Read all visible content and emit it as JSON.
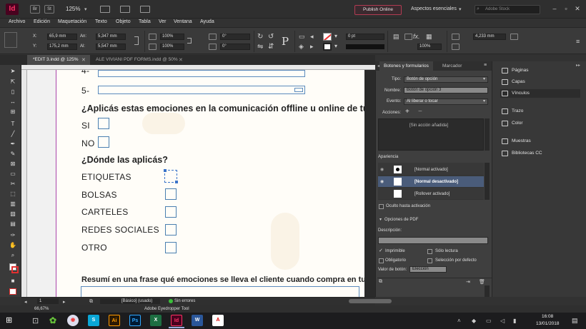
{
  "titlebar": {
    "app_badge": "Id",
    "btn_br": "Br",
    "btn_st": "St",
    "zoom": "125%",
    "publish": "Publish Online",
    "workspace": "Aspectos esenciales",
    "stock_placeholder": "Adobe Stock"
  },
  "menu": [
    "Archivo",
    "Edición",
    "Maquetación",
    "Texto",
    "Objeto",
    "Tabla",
    "Ver",
    "Ventana",
    "Ayuda"
  ],
  "control": {
    "x_label": "X:",
    "x_value": "65,9 mm",
    "y_label": "Y:",
    "y_value": "175,2 mm",
    "w_label": "An:",
    "w_value": "5,347 mm",
    "h_label": "Al:",
    "h_value": "5,547 mm",
    "scale_x": "100%",
    "scale_y": "100%",
    "angle": "0°",
    "shear": "0°",
    "stroke_weight": "0 pt",
    "opacity": "100%",
    "width2": "4,233 mm"
  },
  "tabs": [
    {
      "label": "*EDIT 3.indd @ 125%",
      "active": true
    },
    {
      "label": "ALE VIVIANI PDF FORMS.indd @ 50%",
      "active": false
    }
  ],
  "document": {
    "num4": "4-",
    "num5": "5-",
    "q1": "¿Aplicás estas emociones en la comunicación offline u online de tu m",
    "si": "SI",
    "no": "NO",
    "q2": "¿Dónde las aplicás?",
    "options": [
      "ETIQUETAS",
      "BOLSAS",
      "CARTELES",
      "REDES SOCIALES",
      "OTRO"
    ],
    "q3": "Resumí en una frase qué emociones se lleva el cliente cuando compra en tu lo"
  },
  "panel": {
    "tab_active": "Botones y formularios",
    "tab_other": "Marcador",
    "tipo_label": "Tipo:",
    "tipo_value": "Botón de opción",
    "nombre_label": "Nombre:",
    "nombre_value": "Botón de opción 3",
    "evento_label": "Evento:",
    "evento_value": "Al liberar o tocar",
    "acciones_label": "Acciones:",
    "no_action": "[Sin acción añadida]",
    "apariencia": "Apariencia",
    "states": [
      "[Normal activado]",
      "[Normal desactivado]",
      "[Rollover activado]"
    ],
    "oculto": "Oculto hasta activación",
    "pdf_options": "Opciones de PDF",
    "descripcion": "Descripción:",
    "imprimible": "Imprimible",
    "solo_lectura": "Sólo lectura",
    "obligatorio": "Obligatorio",
    "seleccion": "Selección por defecto",
    "valor_label": "Valor de botón:",
    "valor_value": "Elección"
  },
  "right_panel": [
    "Páginas",
    "Capas",
    "Vínculos",
    "Trazo",
    "Color",
    "Muestras",
    "Bibliotecas CC"
  ],
  "status": {
    "zoom": "66,67%",
    "page": "1",
    "style": "[Básico] (usado)",
    "errors": "Sin errores",
    "tool_hint": "Adobe Eyedropper Tool",
    "time": "16:08",
    "date": "13/01/2018"
  },
  "colors": {
    "accent_red": "#ff3366",
    "selection_blue": "#3a73c9",
    "margin_magenta": "#aa44aa",
    "panel_dark": "#3f3f3f"
  }
}
